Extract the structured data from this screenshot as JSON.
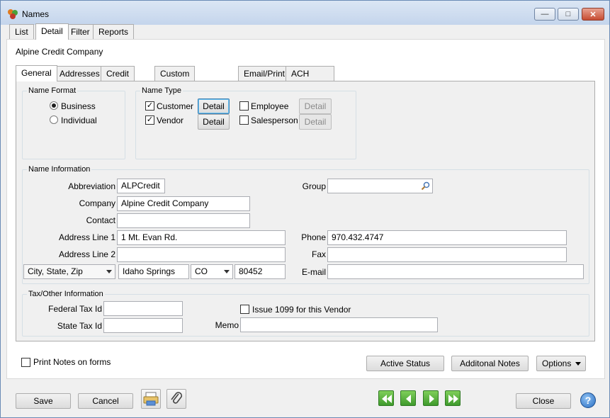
{
  "window": {
    "title": "Names"
  },
  "top_tabs": [
    "List",
    "Detail",
    "Filter",
    "Reports"
  ],
  "company_name": "Alpine Credit Company",
  "inner_tabs": [
    "General",
    "Addresses",
    "Credit Cards",
    "Custom Name Fields",
    "Email/Print",
    "ACH Payments"
  ],
  "name_format": {
    "legend": "Name Format",
    "business": "Business",
    "individual": "Individual"
  },
  "name_type": {
    "legend": "Name Type",
    "customer": "Customer",
    "vendor": "Vendor",
    "employee": "Employee",
    "salesperson": "Salesperson",
    "detail": "Detail"
  },
  "name_info": {
    "legend": "Name Information",
    "abbreviation_label": "Abbreviation",
    "abbreviation": "ALPCredit",
    "company_label": "Company",
    "company": "Alpine Credit Company",
    "contact_label": "Contact",
    "contact": "",
    "address1_label": "Address Line 1",
    "address1": "1 Mt. Evan Rd.",
    "address2_label": "Address Line 2",
    "address2": "",
    "csz_select": "City, State, Zip",
    "city": "Idaho Springs",
    "state": "CO",
    "zip": "80452",
    "group_label": "Group",
    "group": "",
    "phone_label": "Phone",
    "phone": "970.432.4747",
    "fax_label": "Fax",
    "fax": "",
    "email_label": "E-mail",
    "email": ""
  },
  "tax_info": {
    "legend": "Tax/Other Information",
    "federal_label": "Federal Tax Id",
    "federal": "",
    "state_label": "State Tax Id",
    "state": "",
    "issue1099": "Issue 1099 for this Vendor",
    "memo_label": "Memo",
    "memo": ""
  },
  "print_notes": "Print Notes on forms",
  "buttons": {
    "active_status": "Active Status",
    "additional_notes": "Additonal Notes",
    "options": "Options",
    "save": "Save",
    "cancel": "Cancel",
    "close": "Close"
  },
  "colors": {
    "nav_green": "#3f9a2c",
    "help_blue": "#2a6ec2"
  }
}
